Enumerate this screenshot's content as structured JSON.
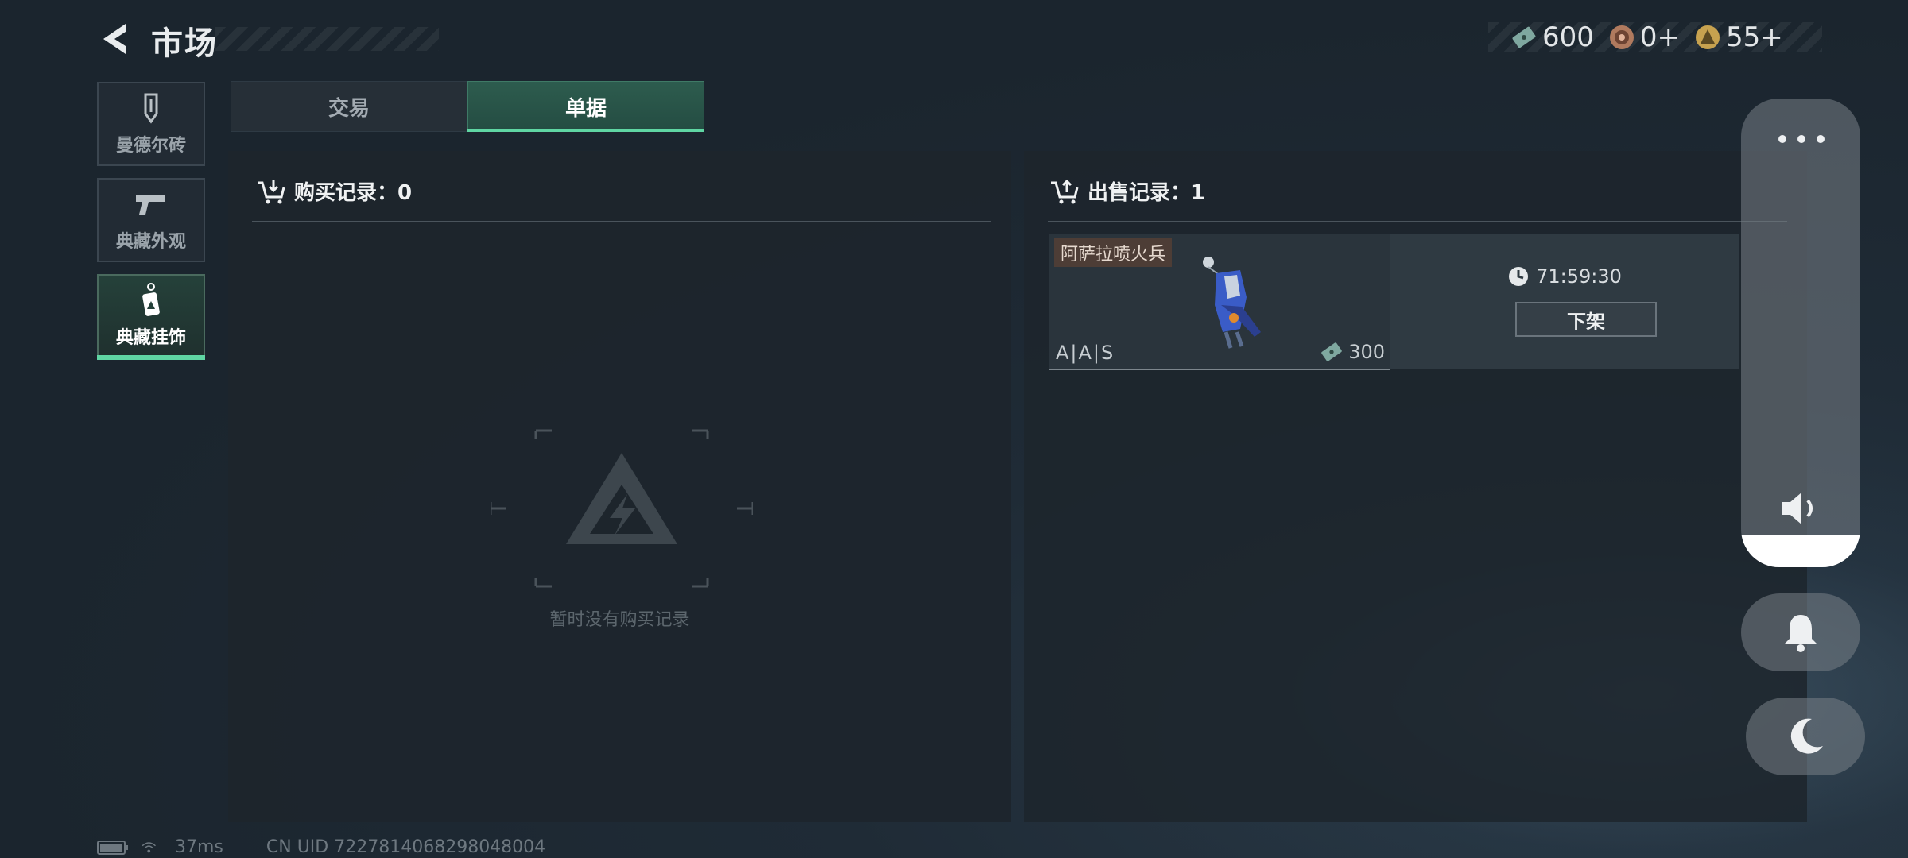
{
  "header": {
    "title": "市场",
    "back_icon": "back-arrow-icon"
  },
  "currencies": [
    {
      "icon": "cash-icon",
      "value": "600"
    },
    {
      "icon": "token-icon",
      "value": "0+"
    },
    {
      "icon": "gold-coin-icon",
      "value": "55+"
    }
  ],
  "categories": [
    {
      "label": "曼德尔砖",
      "icon": "brick-icon",
      "active": false
    },
    {
      "label": "典藏外观",
      "icon": "pistol-icon",
      "active": false
    },
    {
      "label": "典藏挂饰",
      "icon": "charm-tag-icon",
      "active": true
    }
  ],
  "tabs": [
    {
      "label": "交易",
      "active": false
    },
    {
      "label": "单据",
      "active": true
    }
  ],
  "buy_records": {
    "header": "购买记录：0",
    "empty_text": "暂时没有购买记录"
  },
  "sell_records": {
    "header": "出售记录：1",
    "item": {
      "name": "阿萨拉喷火兵",
      "grade": "A|A|S",
      "price": "300",
      "timer": "71:59:30",
      "delist_label": "下架"
    }
  },
  "side_controls": {
    "more": "more-icon",
    "volume": "speaker-icon",
    "bell": "bell-icon",
    "moon": "moon-icon"
  },
  "status": {
    "ping": "37ms",
    "uid": "CN UID 7227814068298048004"
  },
  "colors": {
    "accent": "#5fd6a3",
    "background": "#1c262f",
    "item_tag": "#4d3d36"
  }
}
